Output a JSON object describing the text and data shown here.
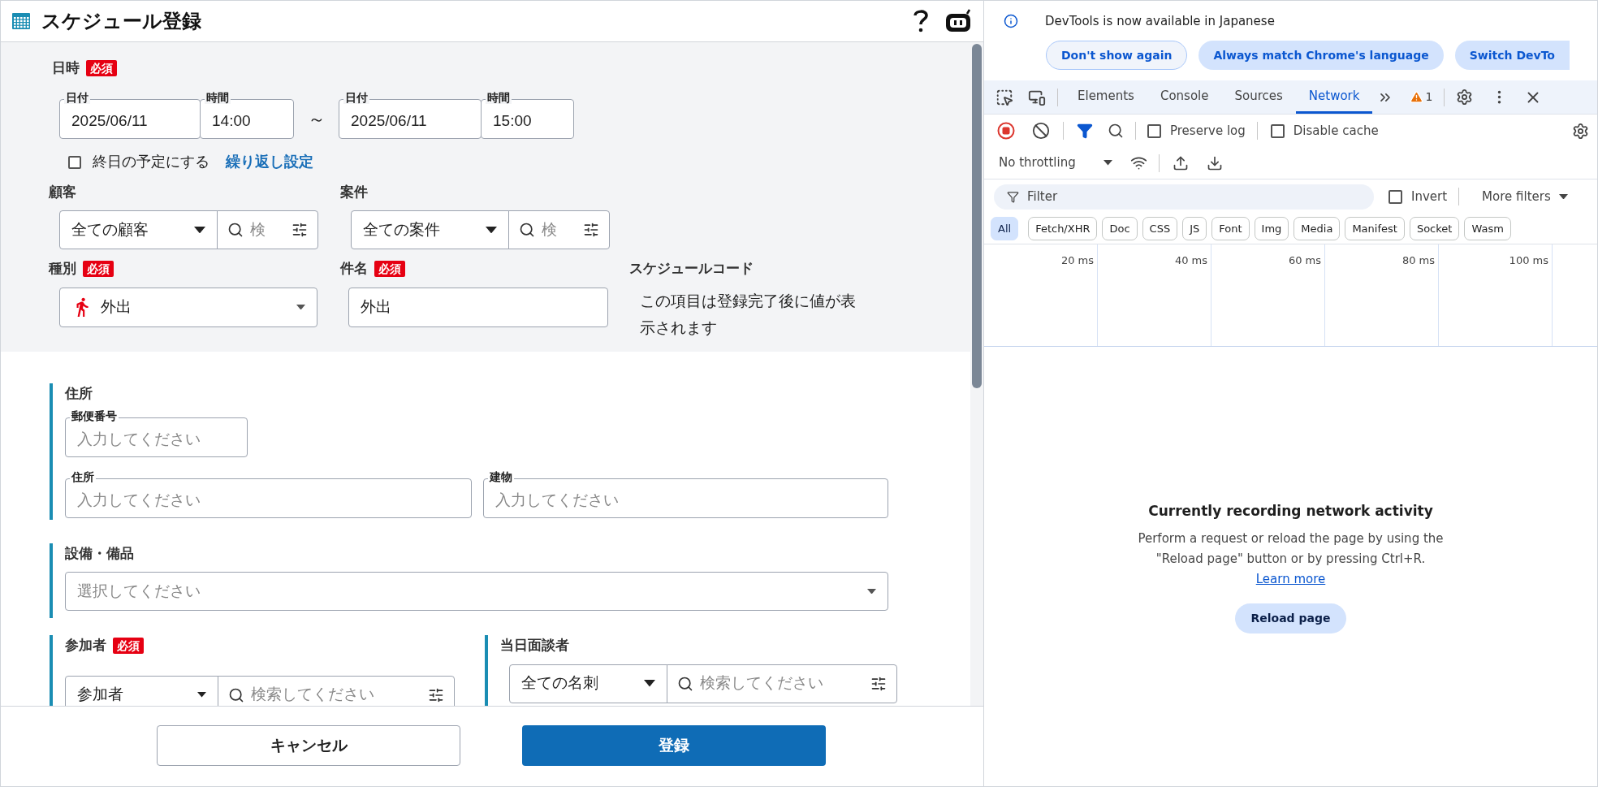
{
  "form": {
    "title": "スケジュール登録",
    "datetime": {
      "label": "日時",
      "required_badge": "必須",
      "separator": "～",
      "ranges": [
        {
          "date_label": "日付",
          "date": "2025/06/11",
          "time_label": "時間",
          "time": "14:00"
        },
        {
          "date_label": "日付",
          "date": "2025/06/11",
          "time_label": "時間",
          "time": "15:00"
        }
      ]
    },
    "all_day": {
      "label": "終日の予定にする",
      "checked": false
    },
    "repeat_link": "繰り返し設定",
    "lookups": [
      {
        "label": "顧客",
        "select": "全ての顧客",
        "search_placeholder": "検"
      },
      {
        "label": "案件",
        "select": "全ての案件",
        "search_placeholder": "検"
      }
    ],
    "type": {
      "label": "種別",
      "required_badge": "必須",
      "value": "外出"
    },
    "subject": {
      "label": "件名",
      "required_badge": "必須",
      "value": "外出"
    },
    "schedule_code": {
      "label": "スケジュールコード",
      "note": "この項目は登録完了後に値が表示されます"
    },
    "address": {
      "label": "住所",
      "postal": {
        "label": "郵便番号",
        "placeholder": "入力してください"
      },
      "fields": [
        {
          "label": "住所",
          "placeholder": "入力してください"
        },
        {
          "label": "建物",
          "placeholder": "入力してください"
        }
      ]
    },
    "equipment": {
      "label": "設備・備品",
      "placeholder": "選択してください"
    },
    "participants": {
      "label": "参加者",
      "required_badge": "必須",
      "select": "参加者",
      "search_placeholder": "検索してください"
    },
    "interviewee": {
      "label": "当日面談者",
      "select": "全ての名刺",
      "search_placeholder": "検索してください"
    },
    "cancel_button": "キャンセル",
    "submit_button": "登録"
  },
  "devtools": {
    "infobar": {
      "message": "DevTools is now available in Japanese",
      "buttons": [
        {
          "label": "Don't show again",
          "kind": "outline"
        },
        {
          "label": "Always match Chrome's language",
          "kind": "filled"
        },
        {
          "label": "Switch DevTo",
          "kind": "filled"
        }
      ]
    },
    "tabs": [
      {
        "label": "Elements",
        "selected": false
      },
      {
        "label": "Console",
        "selected": false
      },
      {
        "label": "Sources",
        "selected": false
      },
      {
        "label": "Network",
        "selected": true
      }
    ],
    "warning_count": "1",
    "preserve_log": {
      "label": "Preserve log",
      "checked": false
    },
    "disable_cache": {
      "label": "Disable cache",
      "checked": false
    },
    "throttling": "No throttling",
    "filter": {
      "placeholder": "Filter"
    },
    "invert": {
      "label": "Invert",
      "checked": false
    },
    "more_filters": "More filters",
    "type_filters": [
      {
        "label": "All",
        "selected": true
      },
      {
        "label": "Fetch/XHR",
        "selected": false
      },
      {
        "label": "Doc",
        "selected": false
      },
      {
        "label": "CSS",
        "selected": false
      },
      {
        "label": "JS",
        "selected": false
      },
      {
        "label": "Font",
        "selected": false
      },
      {
        "label": "Img",
        "selected": false
      },
      {
        "label": "Media",
        "selected": false
      },
      {
        "label": "Manifest",
        "selected": false
      },
      {
        "label": "Socket",
        "selected": false
      },
      {
        "label": "Wasm",
        "selected": false
      }
    ],
    "timeline_ticks": [
      "20 ms",
      "40 ms",
      "60 ms",
      "80 ms",
      "100 ms"
    ],
    "empty_state": {
      "title": "Currently recording network activity",
      "text": "Perform a request or reload the page by using the \"Reload page\" button or by pressing Ctrl+R.",
      "link": "Learn more",
      "button": "Reload page"
    }
  }
}
